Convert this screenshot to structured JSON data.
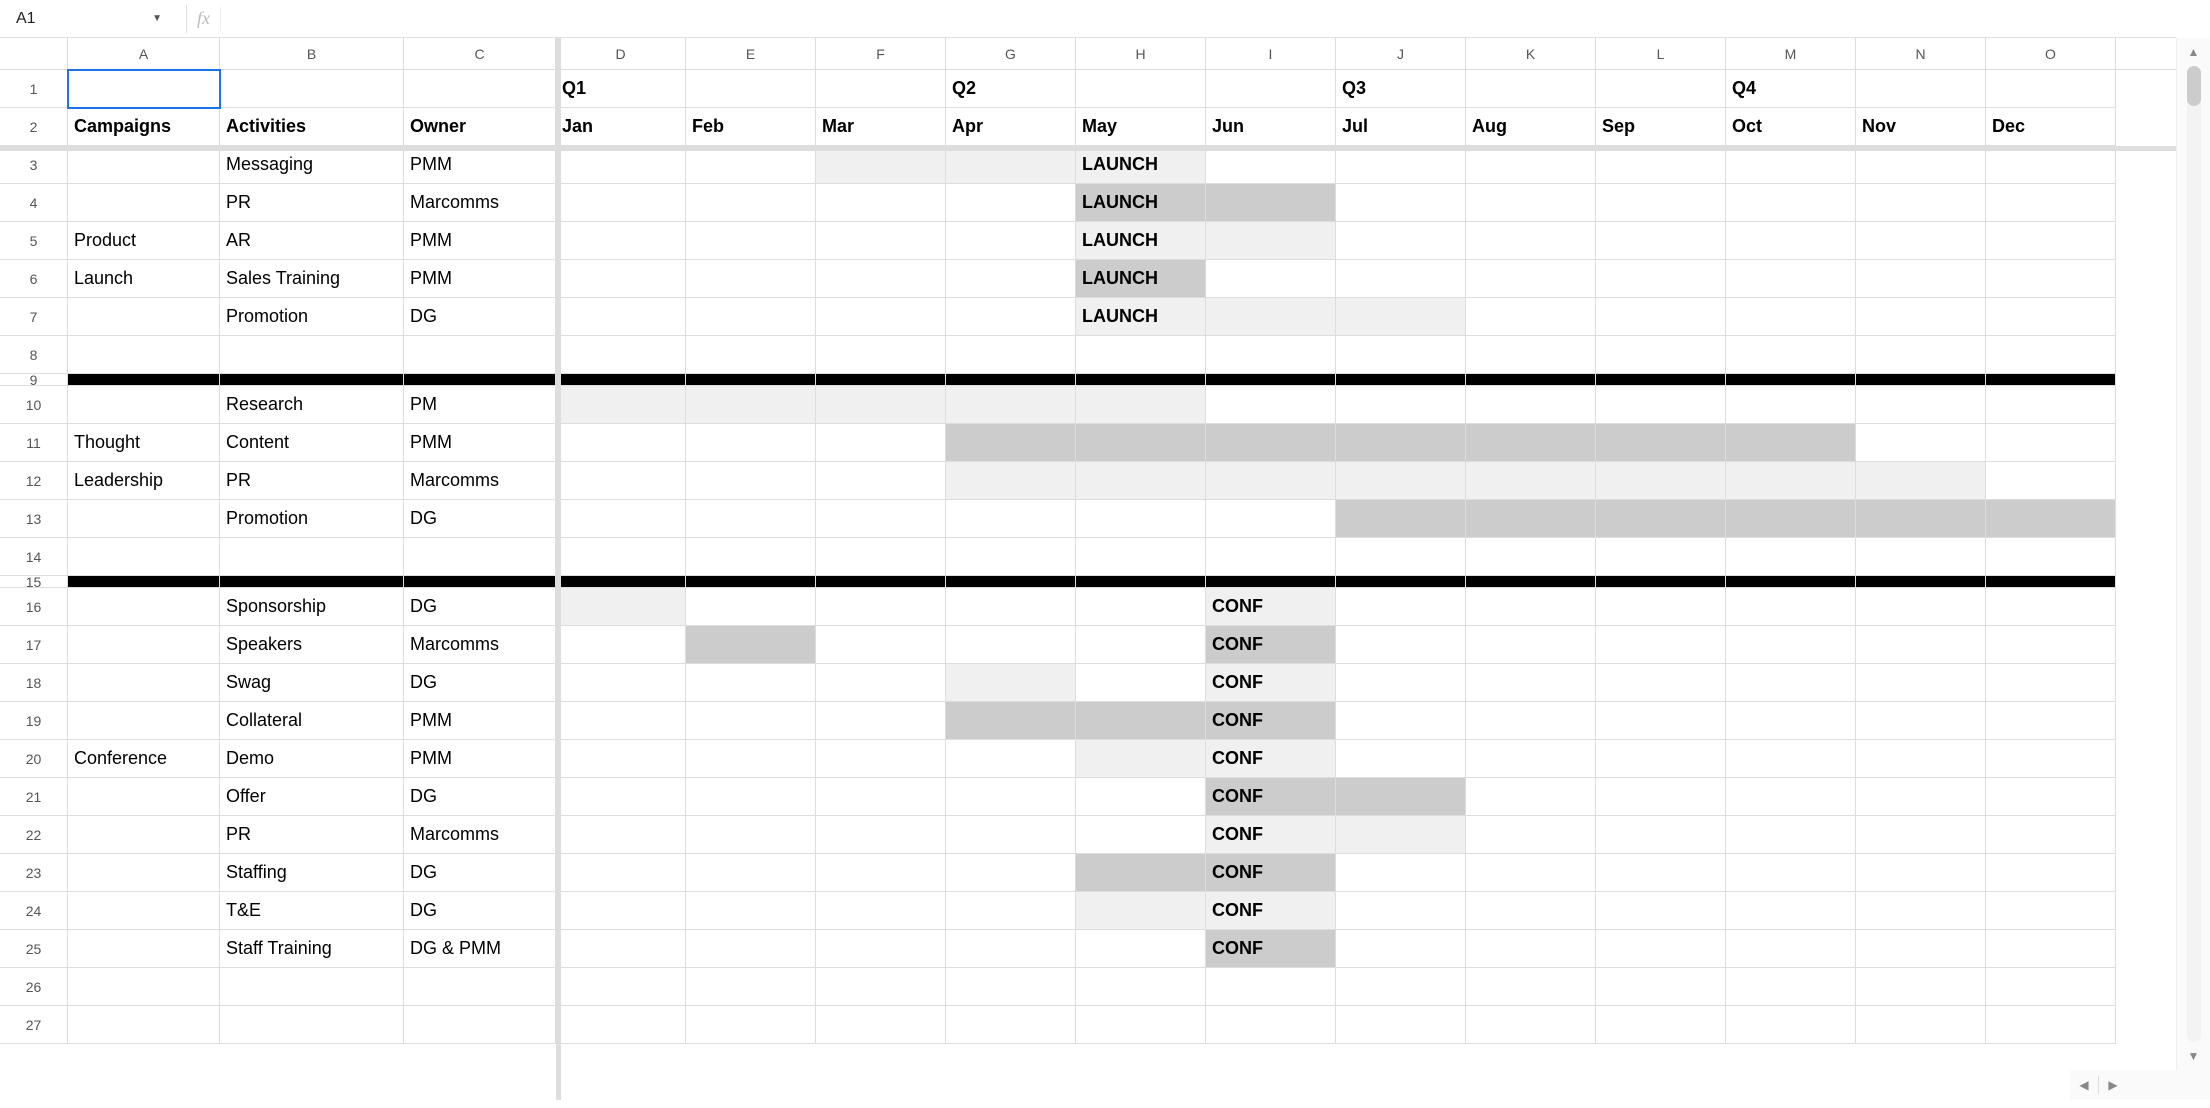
{
  "namebox": "A1",
  "formula": "",
  "columns": [
    "A",
    "B",
    "C",
    "D",
    "E",
    "F",
    "G",
    "H",
    "I",
    "J",
    "K",
    "L",
    "M",
    "N",
    "O"
  ],
  "row_numbers": [
    "1",
    "2",
    "3",
    "4",
    "5",
    "6",
    "7",
    "8",
    "9",
    "10",
    "11",
    "12",
    "13",
    "14",
    "15",
    "16",
    "17",
    "18",
    "19",
    "20",
    "21",
    "22",
    "23",
    "24",
    "25",
    "26",
    "27"
  ],
  "quarters": {
    "D": "Q1",
    "G": "Q2",
    "J": "Q3",
    "M": "Q4"
  },
  "headers": {
    "campaigns": "Campaigns",
    "activities": "Activities",
    "owner": "Owner"
  },
  "months": {
    "D": "Jan",
    "E": "Feb",
    "F": "Mar",
    "G": "Apr",
    "H": "May",
    "I": "Jun",
    "J": "Jul",
    "K": "Aug",
    "L": "Sep",
    "M": "Oct",
    "N": "Nov",
    "O": "Dec"
  },
  "campaigns": {
    "product_launch": "Product Launch",
    "thought_leadership": "Thought Leadership",
    "conference": "Conference"
  },
  "labels": {
    "launch": "LAUNCH",
    "conf": "CONF"
  },
  "rows": {
    "r3": {
      "activity": "Messaging",
      "owner": "PMM",
      "label_col": "H",
      "label": "launch",
      "dark": [],
      "light": [
        "F",
        "G",
        "H"
      ]
    },
    "r4": {
      "activity": "PR",
      "owner": "Marcomms",
      "label_col": "H",
      "label": "launch",
      "dark": [
        "H",
        "I"
      ],
      "light": []
    },
    "r5": {
      "activity": "AR",
      "owner": "PMM",
      "label_col": "H",
      "label": "launch",
      "dark": [],
      "light": [
        "H",
        "I"
      ]
    },
    "r6": {
      "activity": "Sales Training",
      "owner": "PMM",
      "label_col": "H",
      "label": "launch",
      "dark": [
        "H"
      ],
      "light": []
    },
    "r7": {
      "activity": "Promotion",
      "owner": "DG",
      "label_col": "H",
      "label": "launch",
      "dark": [],
      "light": [
        "H",
        "I",
        "J"
      ]
    },
    "r10": {
      "activity": "Research",
      "owner": "PM",
      "dark": [],
      "light": [
        "D",
        "E",
        "F",
        "G",
        "H"
      ]
    },
    "r11": {
      "activity": "Content",
      "owner": "PMM",
      "dark": [
        "G",
        "H",
        "I",
        "J",
        "K",
        "L",
        "M"
      ],
      "light": []
    },
    "r12": {
      "activity": "PR",
      "owner": "Marcomms",
      "dark": [],
      "light": [
        "G",
        "H",
        "I",
        "J",
        "K",
        "L",
        "M",
        "N"
      ]
    },
    "r13": {
      "activity": "Promotion",
      "owner": "DG",
      "dark": [
        "J",
        "K",
        "L",
        "M",
        "N",
        "O"
      ],
      "light": []
    },
    "r16": {
      "activity": "Sponsorship",
      "owner": "DG",
      "label_col": "I",
      "label": "conf",
      "dark": [],
      "light": [
        "D",
        "I"
      ]
    },
    "r17": {
      "activity": "Speakers",
      "owner": "Marcomms",
      "label_col": "I",
      "label": "conf",
      "dark": [
        "E",
        "I"
      ],
      "light": []
    },
    "r18": {
      "activity": "Swag",
      "owner": "DG",
      "label_col": "I",
      "label": "conf",
      "dark": [],
      "light": [
        "G",
        "I"
      ]
    },
    "r19": {
      "activity": "Collateral",
      "owner": "PMM",
      "label_col": "I",
      "label": "conf",
      "dark": [
        "G",
        "H",
        "I"
      ],
      "light": []
    },
    "r20": {
      "activity": "Demo",
      "owner": "PMM",
      "label_col": "I",
      "label": "conf",
      "dark": [],
      "light": [
        "H",
        "I"
      ]
    },
    "r21": {
      "activity": "Offer",
      "owner": "DG",
      "label_col": "I",
      "label": "conf",
      "dark": [
        "I",
        "J"
      ],
      "light": []
    },
    "r22": {
      "activity": "PR",
      "owner": "Marcomms",
      "label_col": "I",
      "label": "conf",
      "dark": [],
      "light": [
        "I",
        "J"
      ]
    },
    "r23": {
      "activity": "Staffing",
      "owner": "DG",
      "label_col": "I",
      "label": "conf",
      "dark": [
        "H",
        "I"
      ],
      "light": []
    },
    "r24": {
      "activity": "T&E",
      "owner": "DG",
      "label_col": "I",
      "label": "conf",
      "dark": [],
      "light": [
        "H",
        "I"
      ]
    },
    "r25": {
      "activity": "Staff Training",
      "owner": "DG & PMM",
      "label_col": "I",
      "label": "conf",
      "dark": [
        "I"
      ],
      "light": []
    }
  },
  "divider_rows": [
    "9",
    "15"
  ],
  "short_rows": [
    "9",
    "15"
  ]
}
